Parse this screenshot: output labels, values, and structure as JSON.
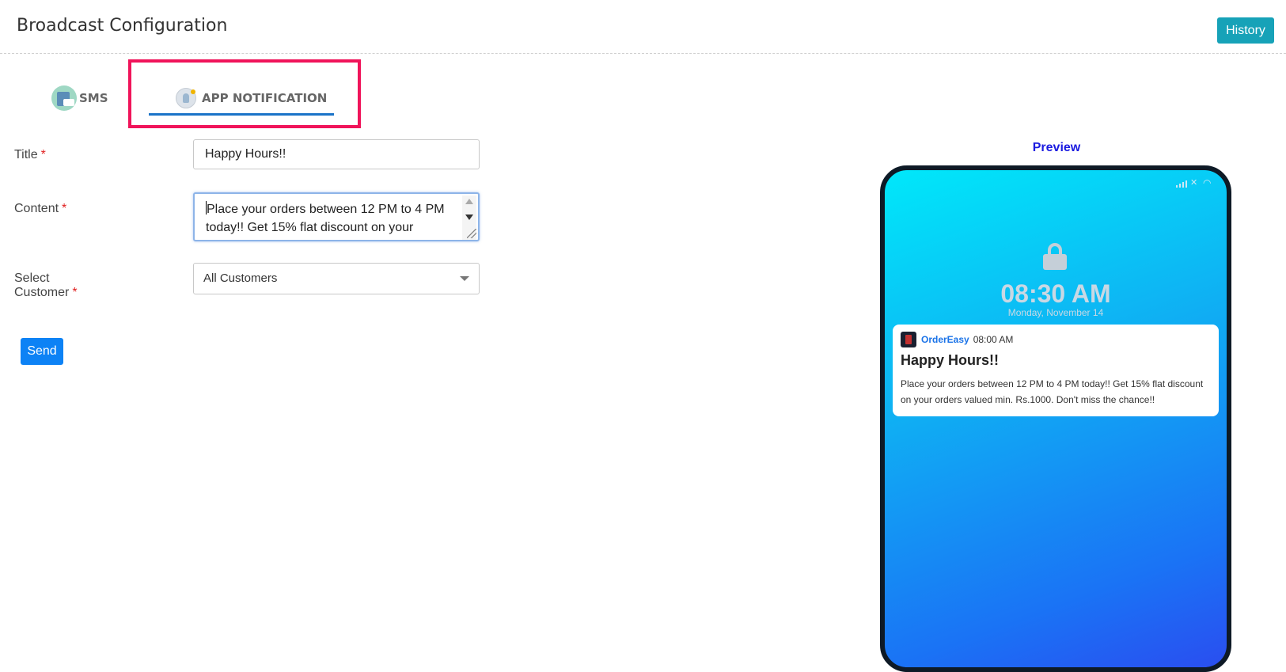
{
  "header": {
    "title": "Broadcast Configuration",
    "history_label": "History"
  },
  "tabs": [
    {
      "label": "SMS",
      "icon": "sms-icon"
    },
    {
      "label": "APP NOTIFICATION",
      "icon": "app-notification-icon",
      "active": true
    }
  ],
  "form": {
    "title_label": "Title",
    "title_value": "Happy Hours!!",
    "content_label": "Content",
    "content_value": "Place your orders between 12 PM to 4 PM today!! Get 15% flat discount on your orders valued min. Rs.1000. Don't miss the chance!!",
    "customer_label": "Select Customer",
    "customer_value": "All Customers",
    "required_mark": "*",
    "send_label": "Send"
  },
  "preview": {
    "label": "Preview",
    "time": "08:30 AM",
    "date": "Monday, November 14",
    "notification": {
      "app_name": "OrderEasy",
      "time": "08:00 AM",
      "title": "Happy Hours!!",
      "body": "Place your orders between 12 PM to 4 PM today!! Get 15% flat discount on your orders valued min. Rs.1000. Don't miss the chance!!"
    }
  },
  "colors": {
    "history_button": "#17a2b8",
    "send_button": "#0d82f5",
    "tab_underline": "#1a73c8",
    "highlight_box": "#f0145a",
    "preview_label": "#1a1ae0",
    "app_name": "#1a73e8"
  }
}
